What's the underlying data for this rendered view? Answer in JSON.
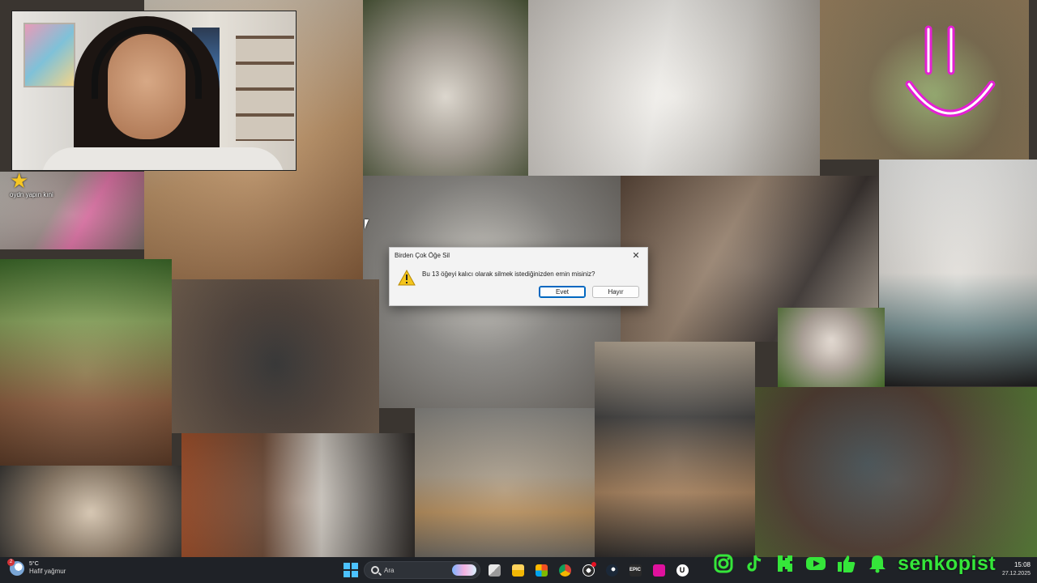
{
  "dialog": {
    "title": "Birden Çok Öğe Sil",
    "message": "Bu 13 öğeyi kalıcı olarak silmek istediğinizden emin misiniz?",
    "buttons": {
      "yes": "Evet",
      "no": "Hayır"
    },
    "close_glyph": "✕",
    "icon": "warning-icon"
  },
  "overlay": {
    "star_alert_text": "oydn yapın kıni",
    "brand": "senkopist",
    "socials": [
      "instagram-icon",
      "tiktok-icon",
      "kick-icon",
      "youtube-icon",
      "thumbs-up-icon",
      "bell-icon"
    ],
    "accent_color": "#35e63a",
    "smiley_color": "#e41fd4"
  },
  "taskbar": {
    "weather_temp": "5°C",
    "weather_desc": "Hafif yağmur",
    "weather_badge": "2",
    "search_placeholder": "Ara",
    "apps": [
      "windows-start-icon",
      "task-view-icon",
      "file-explorer-icon",
      "microsoft-store-icon",
      "chrome-icon",
      "obs-icon",
      "steam-icon",
      "epic-games-icon",
      "davinci-icon",
      "unreal-engine-icon"
    ],
    "epic_label": "EPIC",
    "unreal_label": "U",
    "time": "15:08",
    "date": "27.12.2025"
  }
}
